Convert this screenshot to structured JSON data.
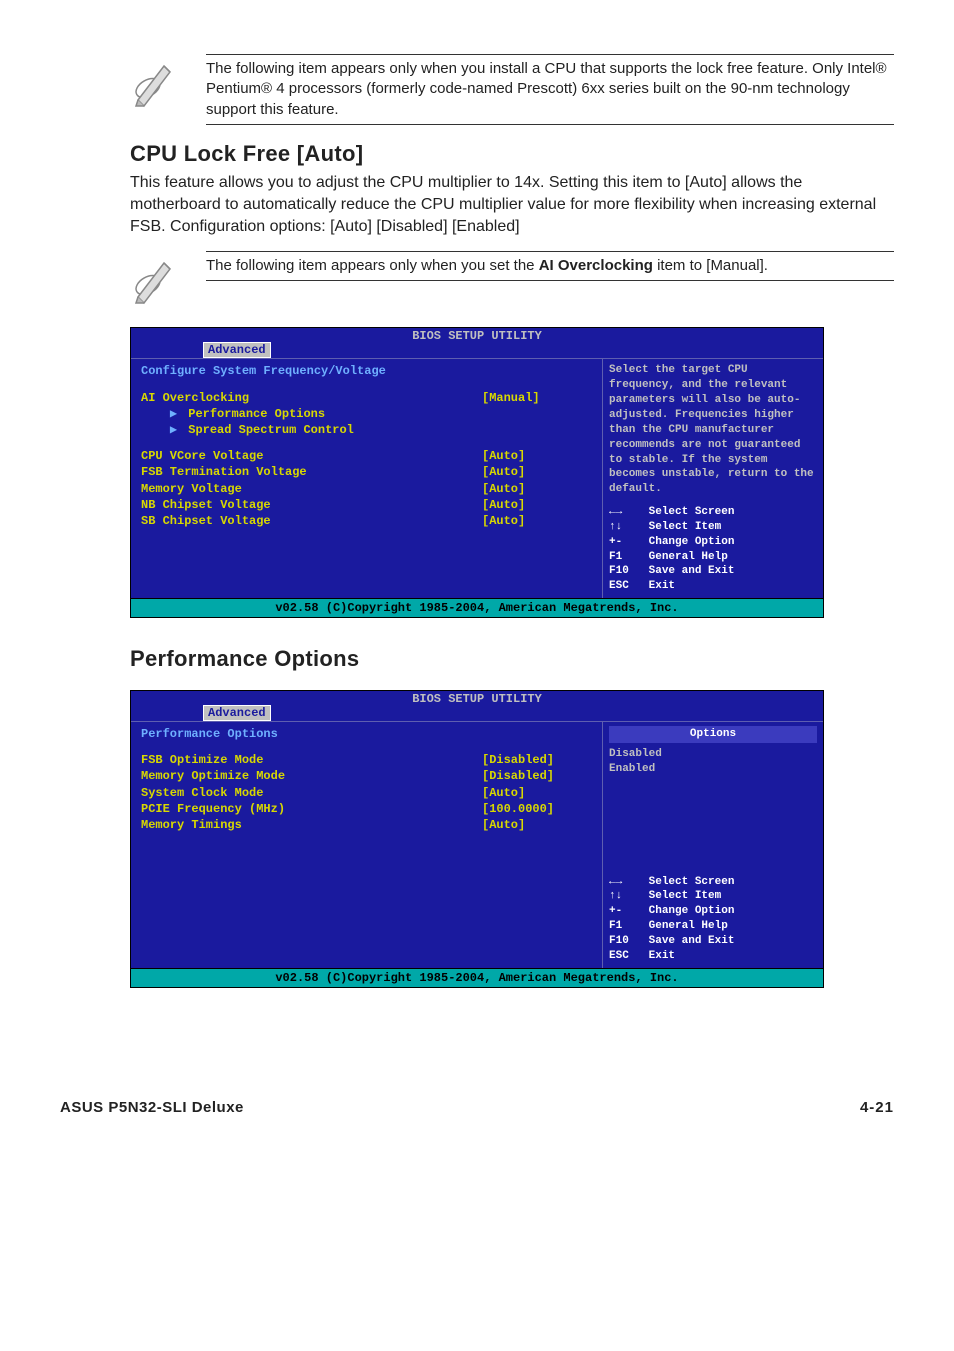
{
  "notes": {
    "note1": "The following item appears only when you install a CPU that supports the lock free feature. Only Intel® Pentium® 4 processors (formerly code-named Prescott) 6xx series built on the 90-nm technology support this feature.",
    "note2_pre": "The following item appears only when you set the ",
    "note2_b": "AI Overclocking",
    "note2_post": " item to [Manual]."
  },
  "section1": {
    "head": "CPU Lock Free [Auto]",
    "body": "This feature allows you to adjust the CPU multiplier to 14x. Setting this item to [Auto] allows the motherboard to automatically reduce the CPU multiplier value for more flexibility when increasing external FSB. Configuration options: [Auto] [Disabled] [Enabled]"
  },
  "section2": {
    "head": "Performance Options"
  },
  "bios_common": {
    "title": "BIOS SETUP UTILITY",
    "tab": "Advanced",
    "footer": "v02.58 (C)Copyright 1985-2004, American Megatrends, Inc.",
    "nav": {
      "lr": "←→",
      "lr_t": "Select Screen",
      "ud": "↑↓",
      "ud_t": "Select Item",
      "pm": "+-",
      "pm_t": "Change Option",
      "f1": "F1",
      "f1_t": "General Help",
      "f10": "F10",
      "f10_t": "Save and Exit",
      "esc": "ESC",
      "esc_t": "Exit"
    }
  },
  "bios1": {
    "heading": "Configure System Frequency/Voltage",
    "items": [
      {
        "label": "AI Overclocking",
        "val": "[Manual]",
        "indent": 0
      },
      {
        "label": "Performance Options",
        "val": "",
        "indent": 1,
        "arrow": true
      },
      {
        "label": "Spread Spectrum Control",
        "val": "",
        "indent": 1,
        "arrow": true
      }
    ],
    "items2": [
      {
        "label": "CPU VCore Voltage",
        "val": "[Auto]"
      },
      {
        "label": "FSB Termination Voltage",
        "val": "[Auto]"
      },
      {
        "label": "Memory Voltage",
        "val": "[Auto]"
      },
      {
        "label": "NB Chipset Voltage",
        "val": "[Auto]"
      },
      {
        "label": "SB Chipset Voltage",
        "val": "[Auto]"
      }
    ],
    "help": "Select the target CPU frequency, and the relevant parameters will also be auto-adjusted. Frequencies higher than the CPU manufacturer recommends are not guaranteed to stable. If the system becomes unstable, return to the default."
  },
  "bios2": {
    "heading": "Performance Options",
    "opt_title": "Options",
    "opts": [
      "Disabled",
      "Enabled"
    ],
    "items": [
      {
        "label": "FSB Optimize Mode",
        "val": "[Disabled]"
      },
      {
        "label": "Memory Optimize Mode",
        "val": "[Disabled]"
      },
      {
        "label": "System Clock Mode",
        "val": "[Auto]"
      },
      {
        "label": "PCIE Frequency (MHz)",
        "val": "[100.0000]"
      },
      {
        "label": "Memory Timings",
        "val": "[Auto]"
      }
    ]
  },
  "page_footer": {
    "left": "ASUS P5N32-SLI Deluxe",
    "right": "4-21"
  }
}
